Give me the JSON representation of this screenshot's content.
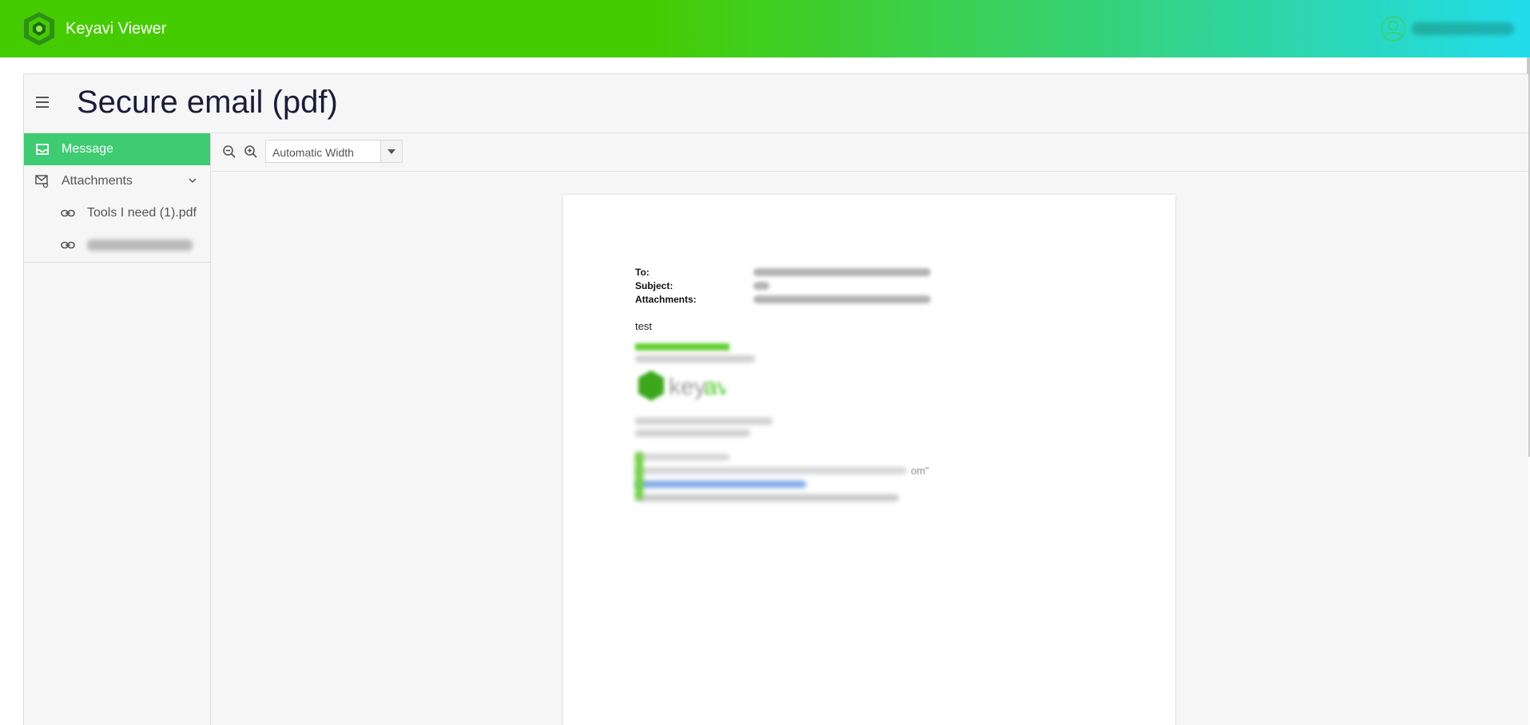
{
  "app": {
    "name": "Keyavi Viewer",
    "brand_color": "#44cc00",
    "accent_color": "#3ecb72"
  },
  "user": {
    "icon": "user-circle-icon"
  },
  "page": {
    "title": "Secure email (pdf)"
  },
  "sidebar": {
    "items": [
      {
        "label": "Message",
        "icon": "inbox-icon",
        "active": true
      },
      {
        "label": "Attachments",
        "icon": "mail-attachment-icon",
        "expanded": true
      }
    ],
    "attachments": [
      {
        "label": "Tools I need (1).pdf",
        "icon": "link-icon"
      },
      {
        "label": "",
        "icon": "link-icon"
      }
    ]
  },
  "toolbar": {
    "zoom_out_icon": "zoom-out-icon",
    "zoom_in_icon": "zoom-in-icon",
    "zoom_value": "Automatic Width"
  },
  "document": {
    "to_label": "To:",
    "subject_label": "Subject:",
    "attachments_label": "Attachments:",
    "body": "test",
    "tail_text": "om\""
  }
}
